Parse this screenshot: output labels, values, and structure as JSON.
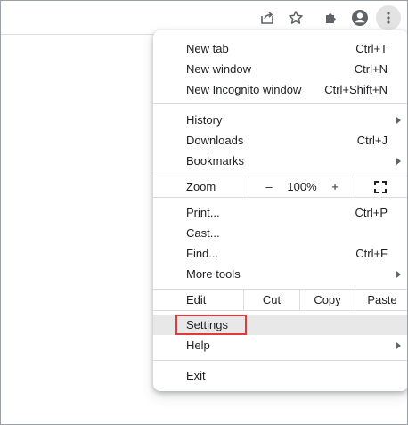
{
  "toolbar": {
    "icons": [
      "share-icon",
      "star-icon",
      "extensions-icon",
      "profile-icon",
      "more-vert-icon"
    ]
  },
  "menu": {
    "new_tab": {
      "label": "New tab",
      "shortcut": "Ctrl+T"
    },
    "new_window": {
      "label": "New window",
      "shortcut": "Ctrl+N"
    },
    "new_incognito": {
      "label": "New Incognito window",
      "shortcut": "Ctrl+Shift+N"
    },
    "history": {
      "label": "History"
    },
    "downloads": {
      "label": "Downloads",
      "shortcut": "Ctrl+J"
    },
    "bookmarks": {
      "label": "Bookmarks"
    },
    "zoom": {
      "label": "Zoom",
      "minus": "–",
      "level": "100%",
      "plus": "+"
    },
    "print": {
      "label": "Print...",
      "shortcut": "Ctrl+P"
    },
    "cast": {
      "label": "Cast..."
    },
    "find": {
      "label": "Find...",
      "shortcut": "Ctrl+F"
    },
    "more_tools": {
      "label": "More tools"
    },
    "edit": {
      "label": "Edit",
      "cut": "Cut",
      "copy": "Copy",
      "paste": "Paste"
    },
    "settings": {
      "label": "Settings"
    },
    "help": {
      "label": "Help"
    },
    "exit": {
      "label": "Exit"
    }
  },
  "colors": {
    "highlight_box": "#e03b3b",
    "hover_bg": "#e8e8e8"
  }
}
